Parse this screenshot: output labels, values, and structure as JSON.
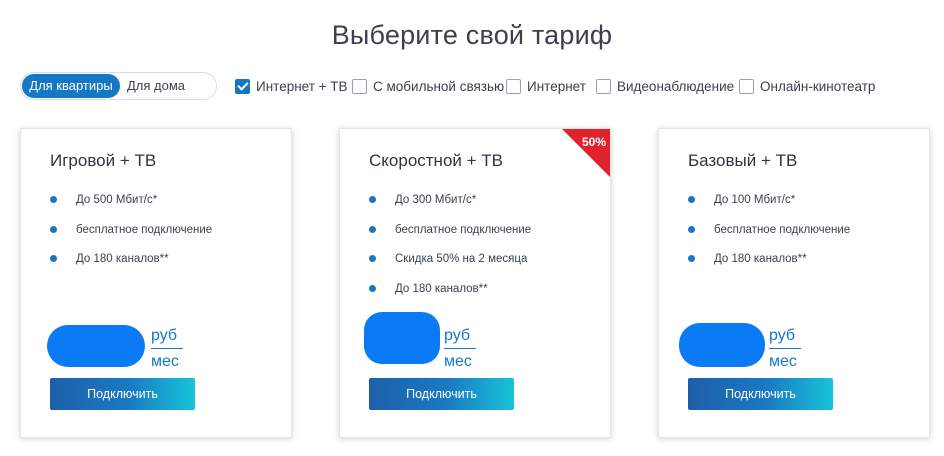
{
  "page": {
    "title": "Выберите свой тариф"
  },
  "toggle": {
    "active": "Для квартиры",
    "inactive": "Для дома"
  },
  "filters": [
    {
      "label": "Интернет + ТВ",
      "checked": true
    },
    {
      "label": "С мобильной связью",
      "checked": false
    },
    {
      "label": "Интернет",
      "checked": false
    },
    {
      "label": "Видеонаблюдение",
      "checked": false
    },
    {
      "label": "Онлайн-кинотеатр",
      "checked": false
    }
  ],
  "cards": [
    {
      "title": "Игровой + ТВ",
      "features": [
        "До 500 Мбит/с*",
        "бесплатное подключение",
        "До 180 каналов**"
      ],
      "price_unit_top": "руб",
      "price_unit_bottom": "мес",
      "button": "Подключить"
    },
    {
      "title": "Скоростной + ТВ",
      "badge": "50%",
      "features": [
        "До 300 Мбит/с*",
        "бесплатное подключение",
        "Скидка 50% на 2 месяца",
        "До 180 каналов**"
      ],
      "price_unit_top": "руб",
      "price_unit_bottom": "мес",
      "button": "Подключить"
    },
    {
      "title": "Базовый + ТВ",
      "features": [
        "До 100 Мбит/с*",
        "бесплатное подключение",
        "До 180 каналов**"
      ],
      "price_unit_top": "руб",
      "price_unit_bottom": "мес",
      "button": "Подключить"
    }
  ],
  "colors": {
    "accent": "#1678c2",
    "badge": "#e0222b",
    "redaction": "#0a7af5"
  }
}
